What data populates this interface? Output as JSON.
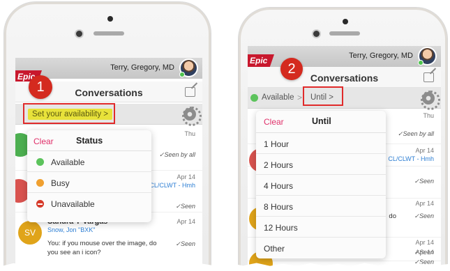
{
  "panel1": {
    "user_name": "Terry, Gregory, MD",
    "logo_text": "Epic",
    "step_badge": "1",
    "title": "Conversations",
    "availability_link": "Set your availability >",
    "popover": {
      "clear": "Clear",
      "title": "Status",
      "options": [
        {
          "label": "Available",
          "color": "#5cc35c"
        },
        {
          "label": "Busy",
          "color": "#f0a030"
        },
        {
          "label": "Unavailable",
          "color": "#d63a2a"
        }
      ]
    },
    "rows": [
      {
        "date": "Thu",
        "seen": "✓Seen by all"
      },
      {
        "date": "Apr 14",
        "ref": "CL/CLWT - Hmh",
        "seen": "✓Seen"
      },
      {
        "avatar": "SV",
        "name": "Sandra Y Vargas",
        "subname": "Snow, Jon \"BXK\"",
        "date": "Apr 14",
        "preview": "You: if you mouse over the image, do you see an i icon?",
        "seen": "✓Seen"
      }
    ]
  },
  "panel2": {
    "user_name": "Terry, Gregory, MD",
    "logo_text": "Epic",
    "step_badge": "2",
    "title": "Conversations",
    "available_label": "Available",
    "until_label": "Until >",
    "popover": {
      "clear": "Clear",
      "title": "Until",
      "options": [
        "1 Hour",
        "2 Hours",
        "4 Hours",
        "8 Hours",
        "12 Hours",
        "Other"
      ]
    },
    "rows": [
      {
        "date": "Thu",
        "seen": "✓Seen by all"
      },
      {
        "date": "Apr 14",
        "ref": "CL/CLWT - Hmh"
      },
      {
        "seen": "✓Seen"
      },
      {
        "date": "Apr 14",
        "snippet": "do",
        "seen": "✓Seen"
      },
      {
        "date": "Apr 14",
        "seen": "✓Seen"
      },
      {
        "date": "Apr 14",
        "seen": "✓Seen"
      }
    ]
  },
  "colors": {
    "accent_red": "#e02a2a",
    "highlight_yellow": "#e8e23a",
    "clear_pink": "#e0306a",
    "epic_red": "#c8182d"
  }
}
